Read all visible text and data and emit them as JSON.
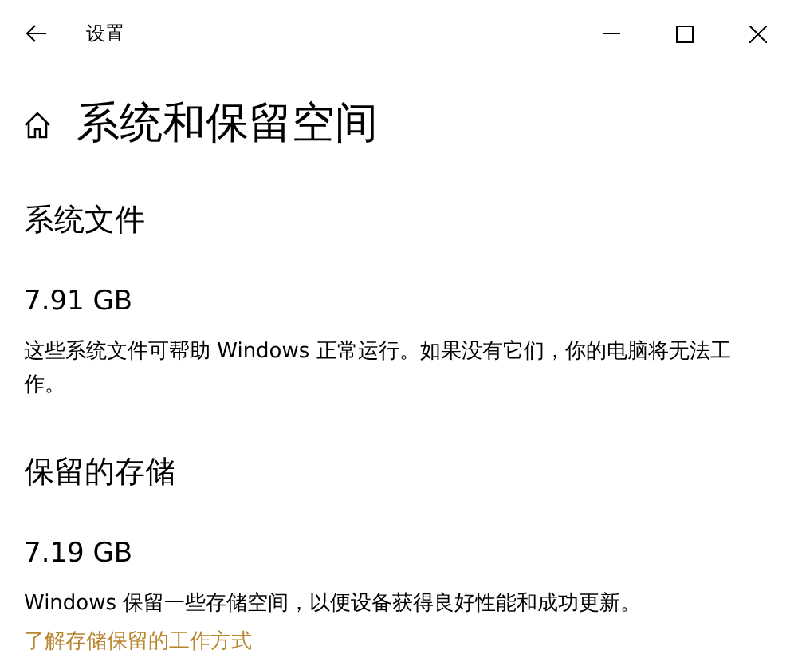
{
  "window": {
    "title": "设置"
  },
  "page": {
    "title": "系统和保留空间"
  },
  "sections": [
    {
      "heading": "系统文件",
      "size": "7.91 GB",
      "description": "这些系统文件可帮助 Windows 正常运行。如果没有它们，你的电脑将无法工作。"
    },
    {
      "heading": "保留的存储",
      "size": "7.19 GB",
      "description": "Windows 保留一些存储空间，以便设备获得良好性能和成功更新。",
      "link": "了解存储保留的工作方式"
    }
  ]
}
